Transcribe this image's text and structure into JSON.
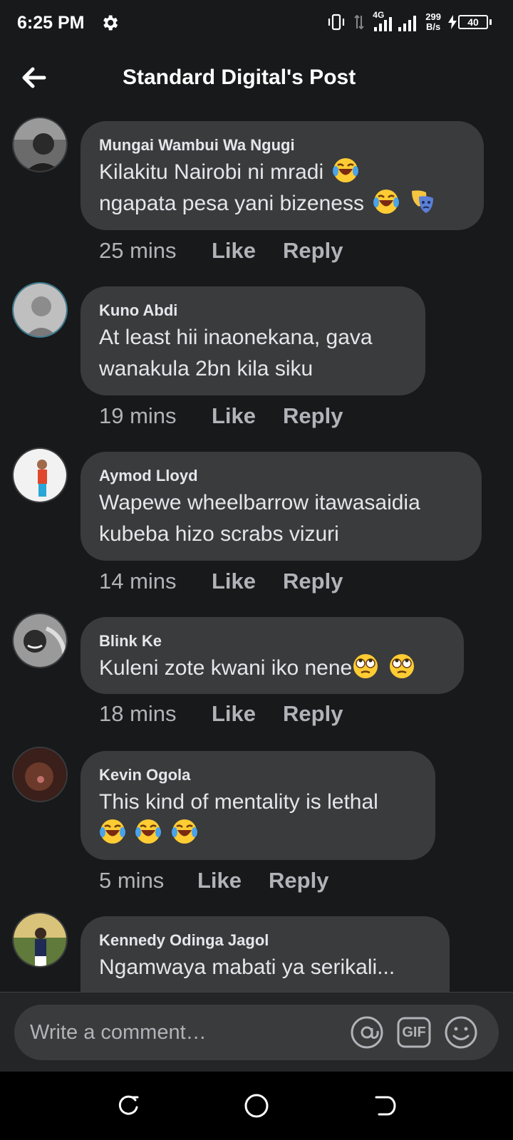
{
  "status_bar": {
    "time": "6:25 PM",
    "network_label": "4G",
    "speed_value": "299",
    "speed_unit": "B/s",
    "battery": "40"
  },
  "header": {
    "title": "Standard Digital's Post",
    "back_icon": "arrow-left-icon"
  },
  "comments": [
    {
      "author": "Mungai Wambui Wa Ngugi",
      "line1": "Kilakitu Nairobi ni mradi",
      "line2": "ngapata pesa yani bizeness",
      "time": "25 mins",
      "like": "Like",
      "reply": "Reply"
    },
    {
      "author": "Kuno Abdi",
      "line1": "At least hii  inaonekana, gava",
      "line2": "wanakula 2bn kila siku",
      "time": "19 mins",
      "like": "Like",
      "reply": "Reply"
    },
    {
      "author": "Aymod Lloyd",
      "line1": "Wapewe wheelbarrow itawasaidia",
      "line2": "kubeba hizo scrabs vizuri",
      "time": "14 mins",
      "like": "Like",
      "reply": "Reply"
    },
    {
      "author": "Blink Ke",
      "line1": "Kuleni zote kwani iko nene",
      "time": "18 mins",
      "like": "Like",
      "reply": "Reply"
    },
    {
      "author": "Kevin Ogola",
      "line1": "This kind of mentality is lethal",
      "time": "5 mins",
      "like": "Like",
      "reply": "Reply"
    },
    {
      "author": "Kennedy Odinga Jagol",
      "line1": "Ngamwaya mabati ya serikali..."
    }
  ],
  "composer": {
    "placeholder": "Write a comment…",
    "gif_label": "GIF"
  },
  "colors": {
    "background": "#18191a",
    "bubble": "#3a3b3c",
    "text": "#e4e6eb",
    "secondary_text": "#b0b3b8",
    "composer_bar": "#242526",
    "nav_bar": "#000000"
  }
}
